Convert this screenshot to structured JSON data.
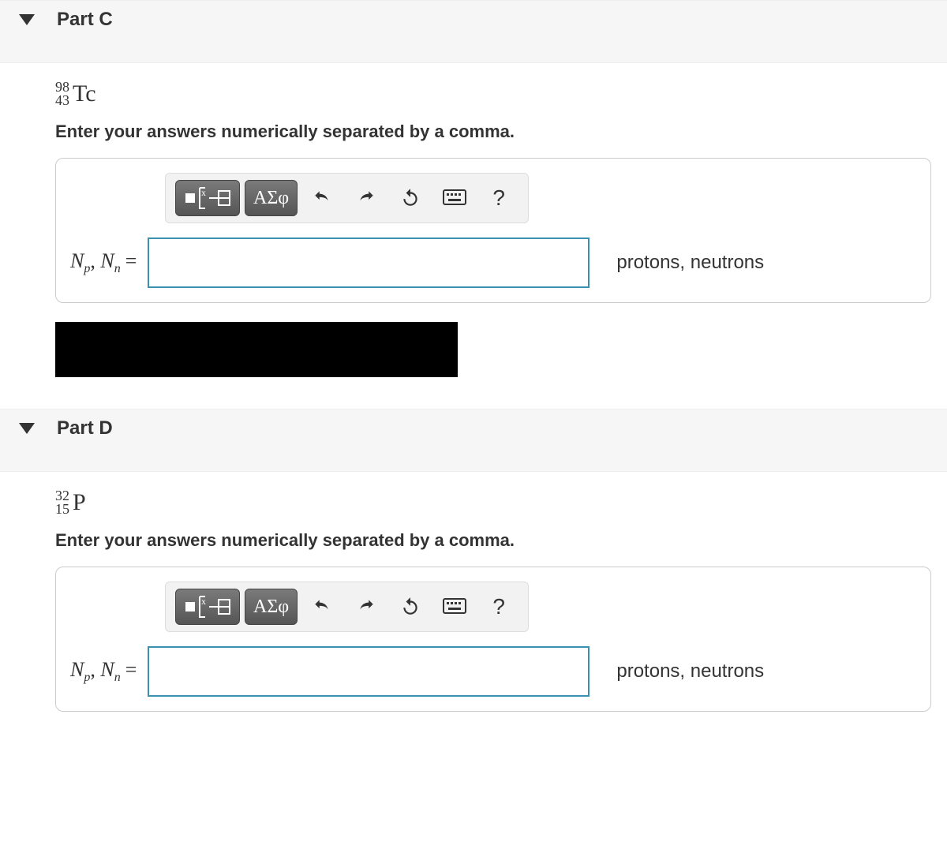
{
  "parts": {
    "c": {
      "title": "Part C",
      "isotope": {
        "mass": "98",
        "atomic": "43",
        "symbol": "Tc"
      },
      "instruction": "Enter your answers numerically separated by a comma.",
      "toolbar": {
        "greek_btn": "ΑΣφ",
        "help": "?"
      },
      "var_label_prefix": "N",
      "var_sub1": "p",
      "var_sub2": "n",
      "equals": "=",
      "answer_value": "",
      "units": "protons, neutrons"
    },
    "d": {
      "title": "Part D",
      "isotope": {
        "mass": "32",
        "atomic": "15",
        "symbol": "P"
      },
      "instruction": "Enter your answers numerically separated by a comma.",
      "toolbar": {
        "greek_btn": "ΑΣφ",
        "help": "?"
      },
      "var_label_prefix": "N",
      "var_sub1": "p",
      "var_sub2": "n",
      "equals": "=",
      "answer_value": "",
      "units": "protons, neutrons"
    }
  }
}
